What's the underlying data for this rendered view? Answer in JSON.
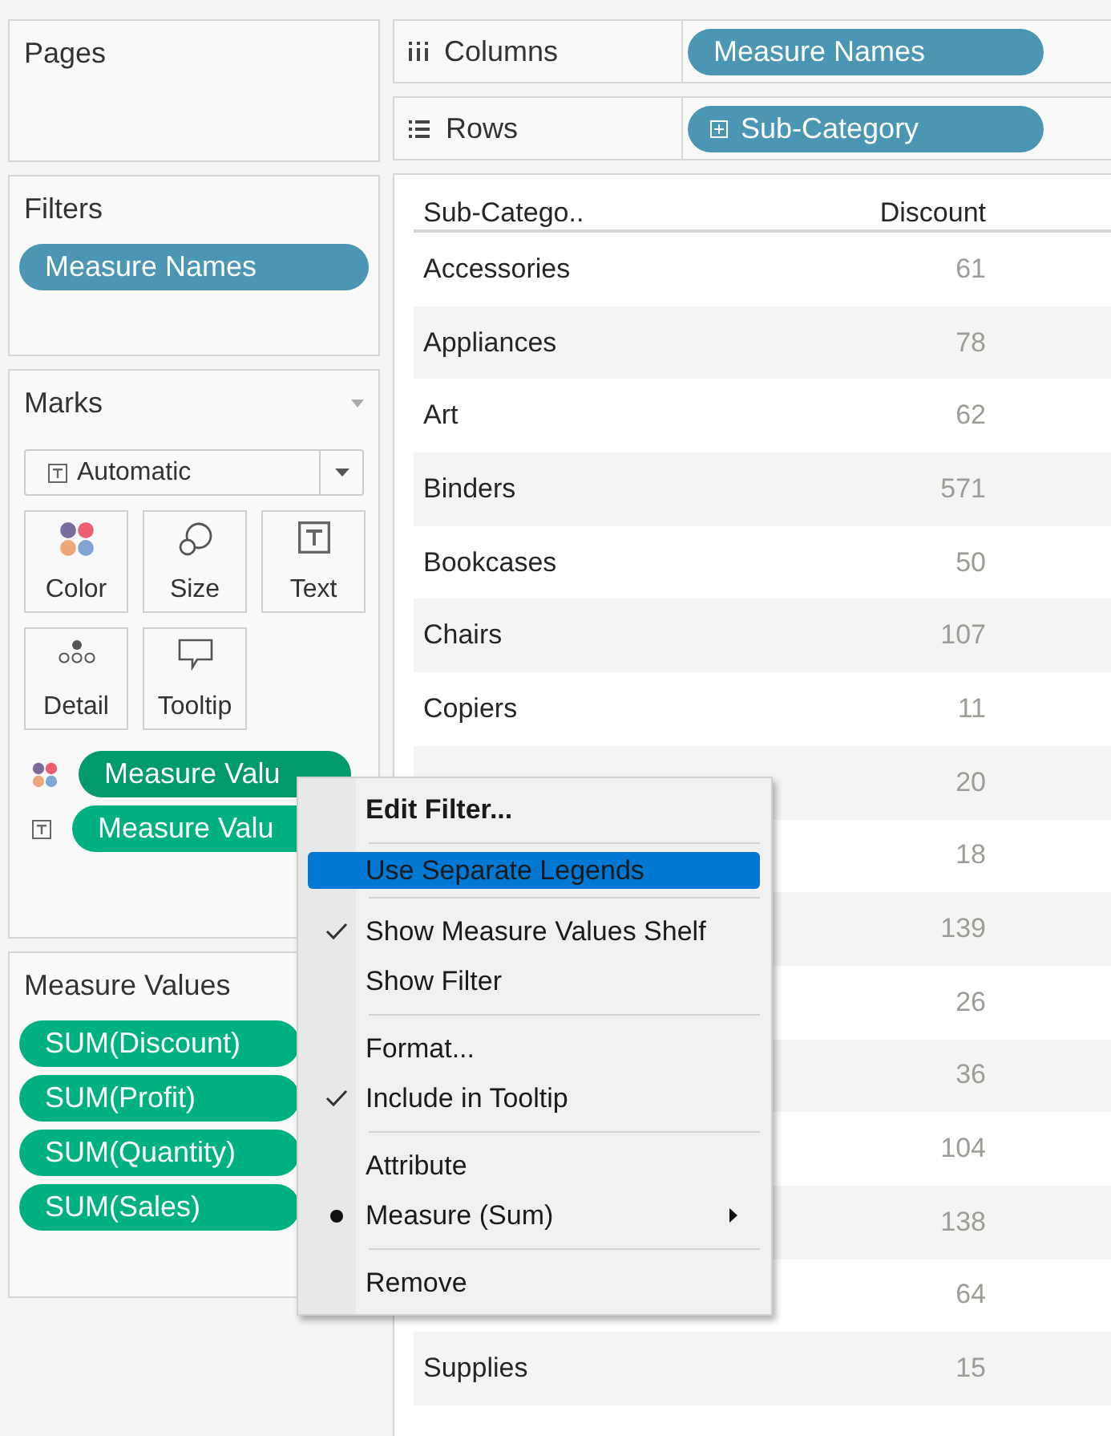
{
  "pages": {
    "title": "Pages"
  },
  "filters": {
    "title": "Filters",
    "pills": [
      {
        "label": "Measure Names"
      }
    ]
  },
  "marks": {
    "title": "Marks",
    "mark_type": {
      "kind": "text",
      "label": "Automatic"
    },
    "cards": [
      {
        "kind": "color",
        "label": "Color"
      },
      {
        "kind": "size",
        "label": "Size"
      },
      {
        "kind": "text",
        "label": "Text"
      },
      {
        "kind": "detail",
        "label": "Detail"
      },
      {
        "kind": "tooltip",
        "label": "Tooltip"
      }
    ],
    "fields": [
      {
        "kind": "color",
        "label": "Measure Valu",
        "selected": true
      },
      {
        "kind": "text",
        "label": "Measure Valu",
        "selected": false
      }
    ]
  },
  "measure_values": {
    "title": "Measure Values",
    "pills": [
      "SUM(Discount)",
      "SUM(Profit)",
      "SUM(Quantity)",
      "SUM(Sales)"
    ]
  },
  "shelves": [
    {
      "kind": "columns",
      "label": "Columns",
      "pill": "Measure Names",
      "expandable": false
    },
    {
      "kind": "rows",
      "label": "Rows",
      "pill": "Sub-Category",
      "expandable": true
    }
  ],
  "table": {
    "columns": [
      "Sub-Catego..",
      "Discount"
    ],
    "rows": [
      {
        "name": "Accessories",
        "value": "61"
      },
      {
        "name": "Appliances",
        "value": "78"
      },
      {
        "name": "Art",
        "value": "62"
      },
      {
        "name": "Binders",
        "value": "571"
      },
      {
        "name": "Bookcases",
        "value": "50"
      },
      {
        "name": "Chairs",
        "value": "107"
      },
      {
        "name": "Copiers",
        "value": "11"
      },
      {
        "value": "20"
      },
      {
        "value": "18"
      },
      {
        "value": "139"
      },
      {
        "value": "26"
      },
      {
        "value": "36"
      },
      {
        "value": "104"
      },
      {
        "value": "138"
      },
      {
        "value": "64"
      },
      {
        "name": "Supplies",
        "value": "15"
      }
    ]
  },
  "context_menu": {
    "groups": [
      [
        {
          "kind": "plain",
          "label": "Edit Filter...",
          "default": true,
          "selected": false,
          "checked": false,
          "submenu": false
        }
      ],
      [
        {
          "kind": "plain",
          "label": "Use Separate Legends",
          "default": false,
          "selected": true,
          "checked": false,
          "submenu": false
        }
      ],
      [
        {
          "kind": "check",
          "label": "Show Measure Values Shelf",
          "default": false,
          "selected": false,
          "checked": true,
          "submenu": false
        },
        {
          "kind": "check",
          "label": "Show Filter",
          "default": false,
          "selected": false,
          "checked": false,
          "submenu": false
        }
      ],
      [
        {
          "kind": "plain",
          "label": "Format...",
          "default": false,
          "selected": false,
          "checked": false,
          "submenu": false
        },
        {
          "kind": "check",
          "label": "Include in Tooltip",
          "default": false,
          "selected": false,
          "checked": true,
          "submenu": false
        }
      ],
      [
        {
          "kind": "radio",
          "label": "Attribute",
          "default": false,
          "selected": false,
          "checked": false,
          "submenu": false
        },
        {
          "kind": "radio",
          "label": "Measure (Sum)",
          "default": false,
          "selected": false,
          "checked": true,
          "submenu": true
        }
      ],
      [
        {
          "kind": "plain",
          "label": "Remove",
          "default": false,
          "selected": false,
          "checked": false,
          "submenu": false
        }
      ]
    ]
  }
}
